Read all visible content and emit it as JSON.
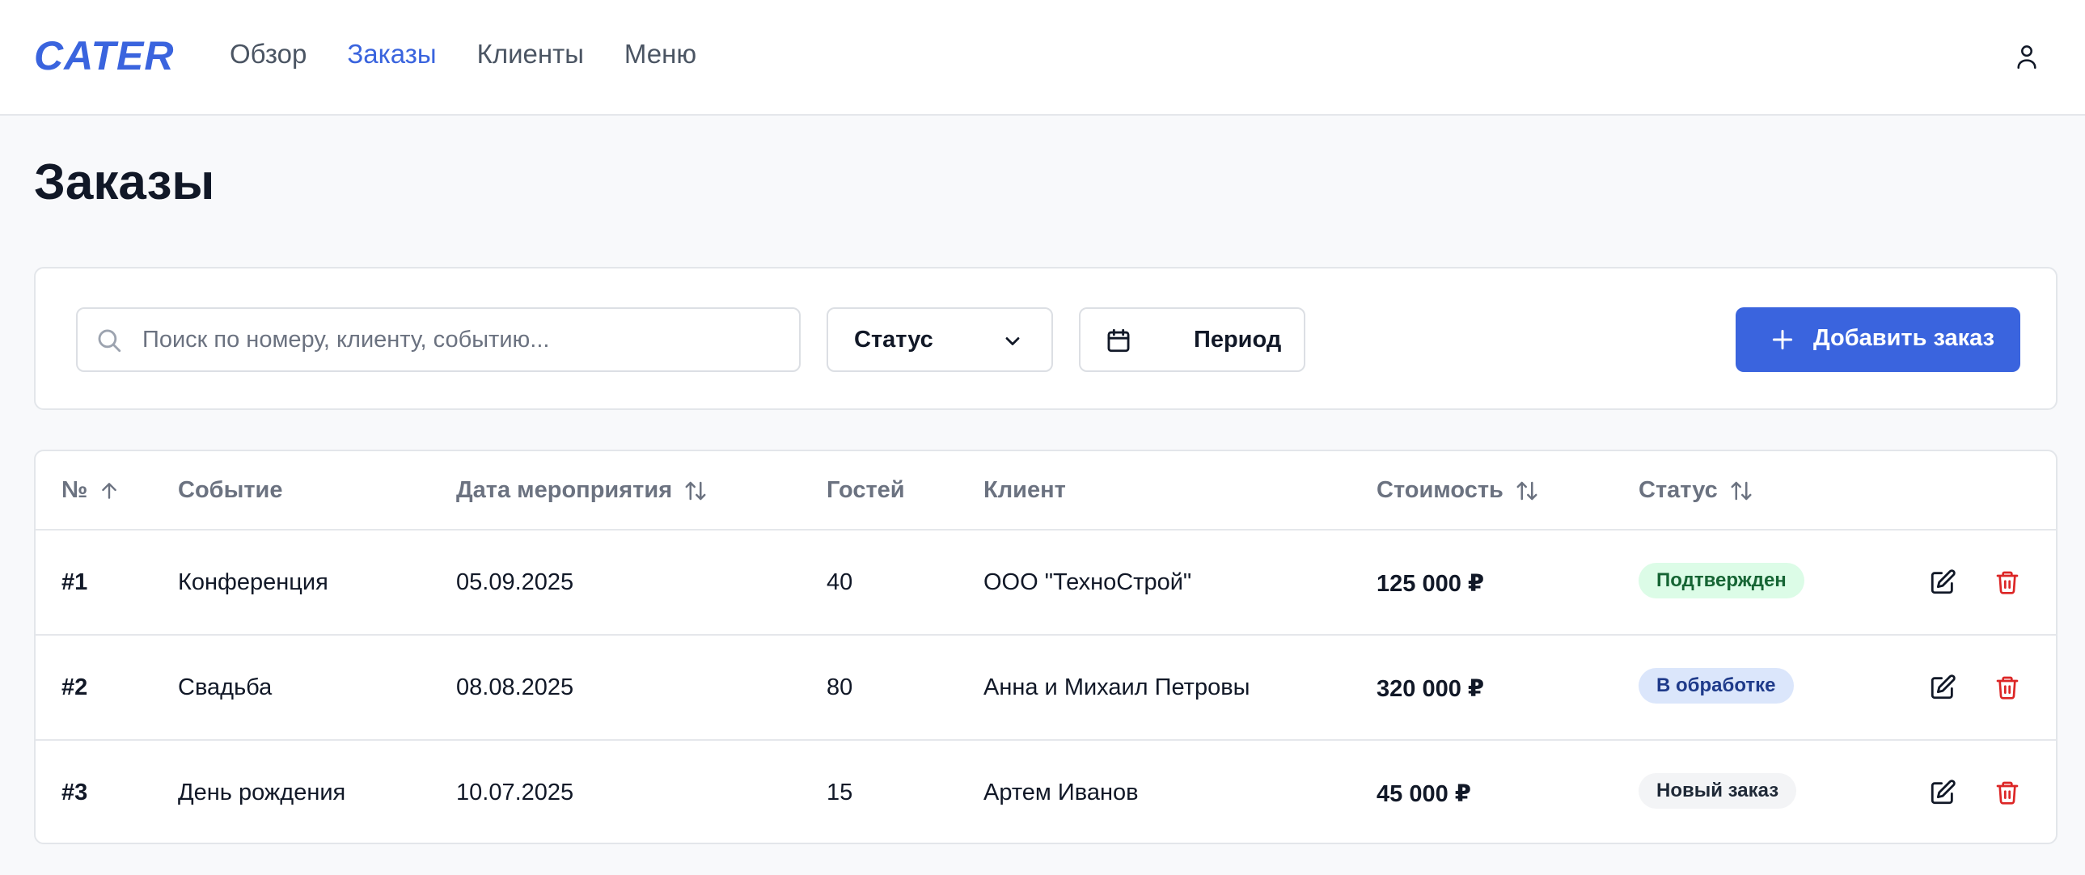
{
  "header": {
    "logo": "CATER",
    "nav": [
      {
        "label": "Обзор",
        "active": false
      },
      {
        "label": "Заказы",
        "active": true
      },
      {
        "label": "Клиенты",
        "active": false
      },
      {
        "label": "Меню",
        "active": false
      }
    ],
    "user_icon": "user-icon"
  },
  "page": {
    "title": "Заказы"
  },
  "toolbar": {
    "search_placeholder": "Поиск по номеру, клиенту, событию...",
    "status_label": "Статус",
    "period_label": "Период",
    "add_label": "Добавить заказ"
  },
  "table": {
    "columns": {
      "num": "№",
      "event": "Событие",
      "date": "Дата мероприятия",
      "guests": "Гостей",
      "client": "Клиент",
      "cost": "Стоимость",
      "status": "Статус"
    },
    "rows": [
      {
        "num": "#1",
        "event": "Конференция",
        "date": "05.09.2025",
        "guests": "40",
        "client": "ООО \"ТехноСтрой\"",
        "cost": "125 000 ₽",
        "status": "Подтвержден",
        "status_color": "#dcfce7"
      },
      {
        "num": "#2",
        "event": "Свадьба",
        "date": "08.08.2025",
        "guests": "80",
        "client": "Анна и Михаил Петровы",
        "cost": "320 000 ₽",
        "status": "В обработке",
        "status_color": "#dbe6fb"
      },
      {
        "num": "#3",
        "event": "День рождения",
        "date": "10.07.2025",
        "guests": "15",
        "client": "Артем Иванов",
        "cost": "45 000 ₽",
        "status": "Новый заказ",
        "status_color": "#f3f4f6"
      }
    ]
  },
  "colors": {
    "accent": "#3a64de",
    "delete": "#dc2626"
  }
}
